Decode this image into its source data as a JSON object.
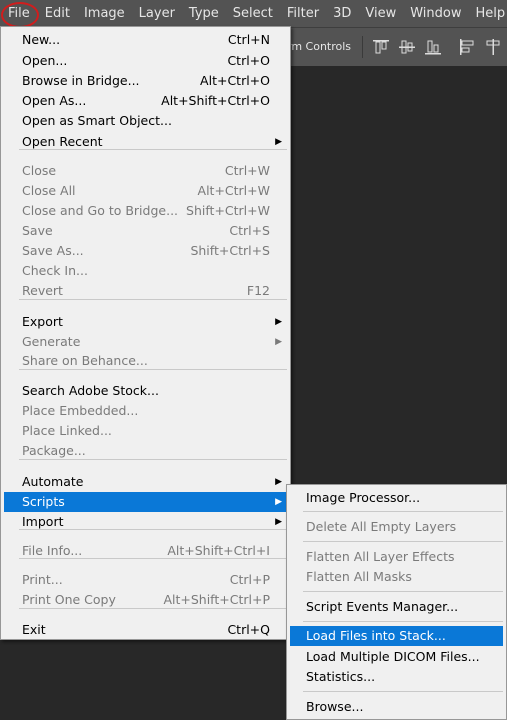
{
  "menubar": {
    "items": [
      "File",
      "Edit",
      "Image",
      "Layer",
      "Type",
      "Select",
      "Filter",
      "3D",
      "View",
      "Window",
      "Help"
    ]
  },
  "optionsbar": {
    "transform_label": "rm Controls"
  },
  "file_menu": {
    "items": [
      {
        "label": "New...",
        "shortcut": "Ctrl+N",
        "disabled": false
      },
      {
        "label": "Open...",
        "shortcut": "Ctrl+O",
        "disabled": false
      },
      {
        "label": "Browse in Bridge...",
        "shortcut": "Alt+Ctrl+O",
        "disabled": false
      },
      {
        "label": "Open As...",
        "shortcut": "Alt+Shift+Ctrl+O",
        "disabled": false
      },
      {
        "label": "Open as Smart Object...",
        "shortcut": "",
        "disabled": false
      },
      {
        "label": "Open Recent",
        "shortcut": "",
        "disabled": false,
        "submenu": true
      },
      {
        "label": "Close",
        "shortcut": "Ctrl+W",
        "disabled": true
      },
      {
        "label": "Close All",
        "shortcut": "Alt+Ctrl+W",
        "disabled": true
      },
      {
        "label": "Close and Go to Bridge...",
        "shortcut": "Shift+Ctrl+W",
        "disabled": true
      },
      {
        "label": "Save",
        "shortcut": "Ctrl+S",
        "disabled": true
      },
      {
        "label": "Save As...",
        "shortcut": "Shift+Ctrl+S",
        "disabled": true
      },
      {
        "label": "Check In...",
        "shortcut": "",
        "disabled": true
      },
      {
        "label": "Revert",
        "shortcut": "F12",
        "disabled": true
      },
      {
        "label": "Export",
        "shortcut": "",
        "disabled": false,
        "submenu": true
      },
      {
        "label": "Generate",
        "shortcut": "",
        "disabled": true,
        "submenu": true
      },
      {
        "label": "Share on Behance...",
        "shortcut": "",
        "disabled": true
      },
      {
        "label": "Search Adobe Stock...",
        "shortcut": "",
        "disabled": false
      },
      {
        "label": "Place Embedded...",
        "shortcut": "",
        "disabled": true
      },
      {
        "label": "Place Linked...",
        "shortcut": "",
        "disabled": true
      },
      {
        "label": "Package...",
        "shortcut": "",
        "disabled": true
      },
      {
        "label": "Automate",
        "shortcut": "",
        "disabled": false,
        "submenu": true
      },
      {
        "label": "Scripts",
        "shortcut": "",
        "disabled": false,
        "submenu": true,
        "highlighted": true
      },
      {
        "label": "Import",
        "shortcut": "",
        "disabled": false,
        "submenu": true
      },
      {
        "label": "File Info...",
        "shortcut": "Alt+Shift+Ctrl+I",
        "disabled": true
      },
      {
        "label": "Print...",
        "shortcut": "Ctrl+P",
        "disabled": true
      },
      {
        "label": "Print One Copy",
        "shortcut": "Alt+Shift+Ctrl+P",
        "disabled": true
      },
      {
        "label": "Exit",
        "shortcut": "Ctrl+Q",
        "disabled": false
      }
    ]
  },
  "scripts_menu": {
    "items": [
      {
        "label": "Image Processor...",
        "disabled": false
      },
      {
        "label": "Delete All Empty Layers",
        "disabled": true
      },
      {
        "label": "Flatten All Layer Effects",
        "disabled": true
      },
      {
        "label": "Flatten All Masks",
        "disabled": true
      },
      {
        "label": "Script Events Manager...",
        "disabled": false
      },
      {
        "label": "Load Files into Stack...",
        "disabled": false,
        "highlighted": true
      },
      {
        "label": "Load Multiple DICOM Files...",
        "disabled": false
      },
      {
        "label": "Statistics...",
        "disabled": false
      },
      {
        "label": "Browse...",
        "disabled": false
      }
    ]
  },
  "colors": {
    "highlight": "#0a78d7",
    "menubar": "#535353",
    "annotation_circle": "#d11d1d"
  }
}
